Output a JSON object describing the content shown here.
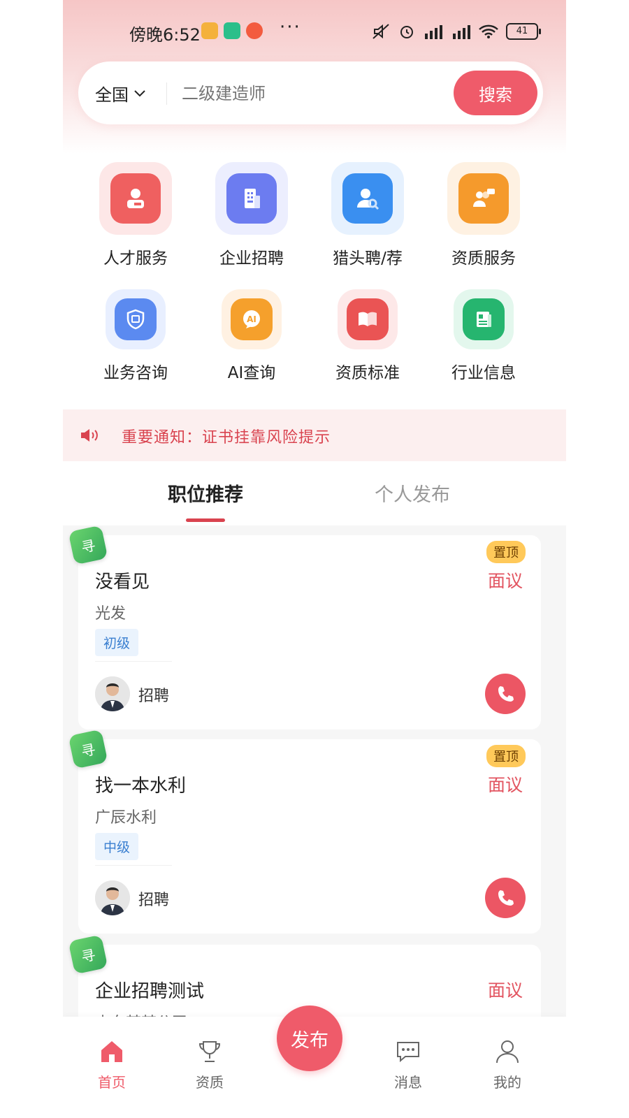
{
  "status_bar": {
    "time": "傍晚6:52",
    "dots": "···",
    "battery": "41"
  },
  "search": {
    "region": "全国",
    "placeholder": "二级建造师",
    "button": "搜索"
  },
  "grid": [
    {
      "label": "人才服务",
      "icon": "person-card-icon",
      "color": "#ef6060"
    },
    {
      "label": "企业招聘",
      "icon": "building-icon",
      "color": "#6c7cf0"
    },
    {
      "label": "猎头聘/荐",
      "icon": "person-search-icon",
      "color": "#3a8ff0"
    },
    {
      "label": "资质服务",
      "icon": "people-chat-icon",
      "color": "#f59a2c"
    },
    {
      "label": "业务咨询",
      "icon": "shield-icon",
      "color": "#5b8af0"
    },
    {
      "label": "AI查询",
      "icon": "ai-icon",
      "color": "#f5a02c"
    },
    {
      "label": "资质标准",
      "icon": "book-icon",
      "color": "#ea5454"
    },
    {
      "label": "行业信息",
      "icon": "news-icon",
      "color": "#26b56f"
    }
  ],
  "notice": {
    "text": "重要通知：证书挂靠风险提示"
  },
  "tabs": [
    {
      "label": "职位推荐"
    },
    {
      "label": "个人发布"
    }
  ],
  "cards": [
    {
      "badge": "寻",
      "pin": "置顶",
      "title": "没看见",
      "salary": "面议",
      "company": "光发",
      "level": "初级",
      "role": "招聘"
    },
    {
      "badge": "寻",
      "pin": "置顶",
      "title": "找一本水利",
      "salary": "面议",
      "company": "广辰水利",
      "level": "中级",
      "role": "招聘"
    },
    {
      "badge": "寻",
      "title": "企业招聘测试",
      "salary": "面议",
      "company": "山东某某公司"
    }
  ],
  "bottom_nav": [
    {
      "label": "首页",
      "icon": "home-icon",
      "active": true
    },
    {
      "label": "资质",
      "icon": "trophy-icon"
    },
    {
      "label": "发布"
    },
    {
      "label": "消息",
      "icon": "chat-icon"
    },
    {
      "label": "我的",
      "icon": "user-icon"
    }
  ],
  "colors": {
    "accent": "#ef5b6a",
    "notice_text": "#d9434f"
  }
}
